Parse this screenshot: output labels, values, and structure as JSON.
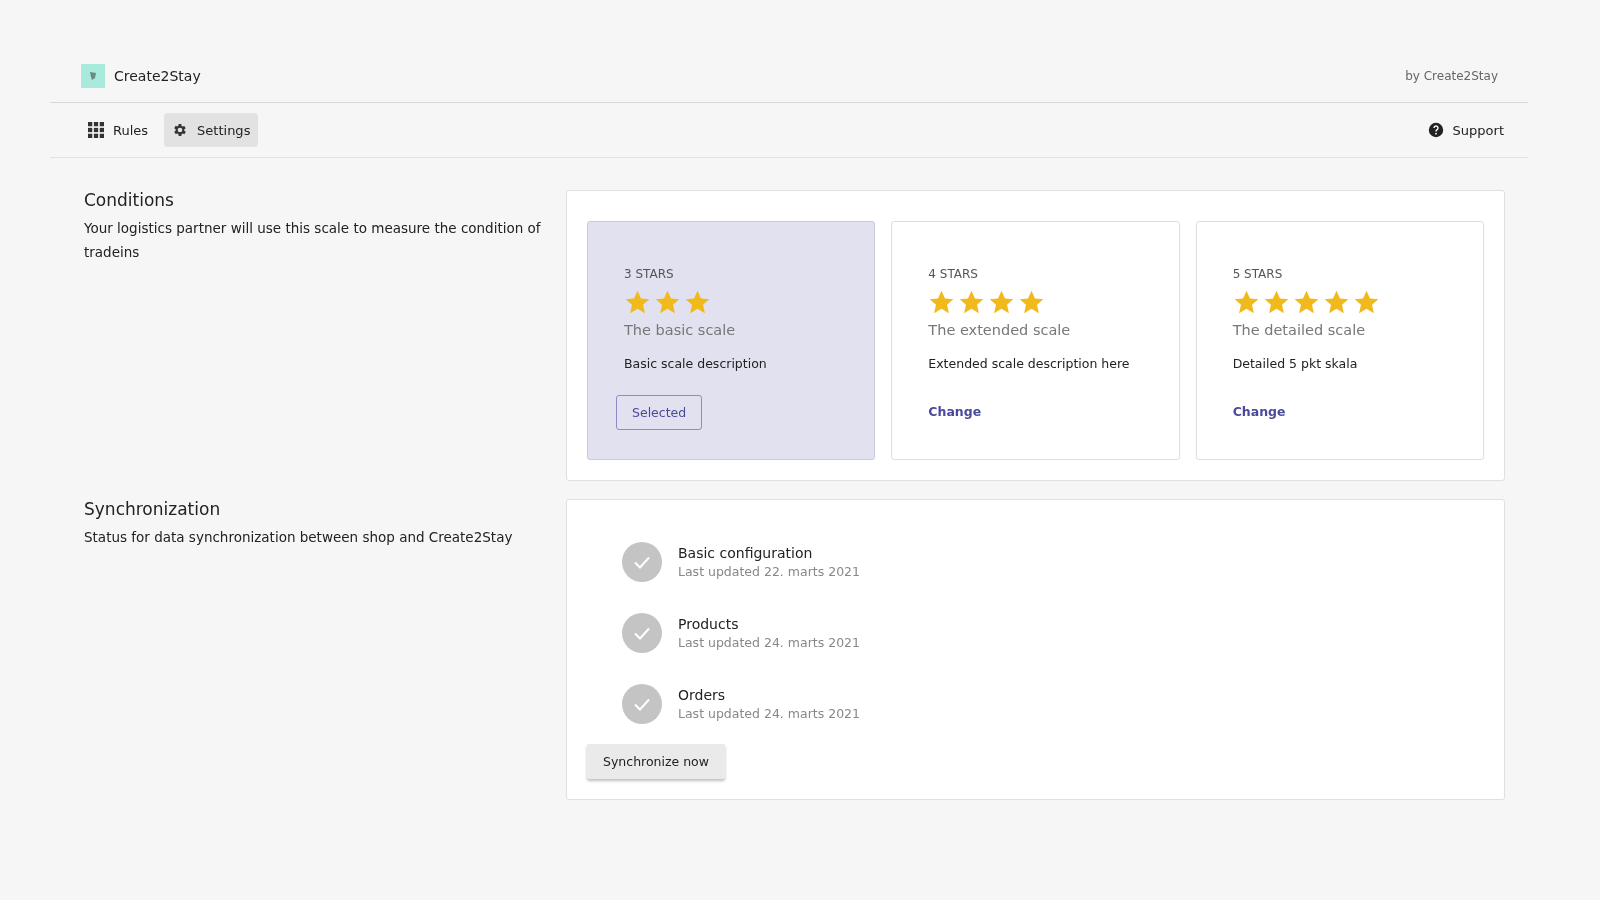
{
  "header": {
    "app_name": "Create2Stay",
    "byline": "by Create2Stay"
  },
  "nav": {
    "tabs": [
      {
        "label": "Rules",
        "selected": false
      },
      {
        "label": "Settings",
        "selected": true
      }
    ],
    "support": "Support"
  },
  "conditions": {
    "title": "Conditions",
    "description": "Your logistics partner will use this scale to measure the condition of tradeins",
    "scales": [
      {
        "heading": "3 STARS",
        "stars": 3,
        "name": "The basic scale",
        "description": "Basic scale description",
        "action": "Selected",
        "selected": true
      },
      {
        "heading": "4 STARS",
        "stars": 4,
        "name": "The extended scale",
        "description": "Extended scale description here",
        "action": "Change",
        "selected": false
      },
      {
        "heading": "5 STARS",
        "stars": 5,
        "name": "The detailed scale",
        "description": "Detailed 5 pkt skala",
        "action": "Change",
        "selected": false
      }
    ]
  },
  "synchronization": {
    "title": "Synchronization",
    "description": "Status for data synchronization between shop and Create2Stay",
    "items": [
      {
        "name": "Basic configuration",
        "updated": "Last updated 22. marts 2021"
      },
      {
        "name": "Products",
        "updated": "Last updated 24. marts 2021"
      },
      {
        "name": "Orders",
        "updated": "Last updated 24. marts 2021"
      }
    ],
    "button": "Synchronize now"
  }
}
